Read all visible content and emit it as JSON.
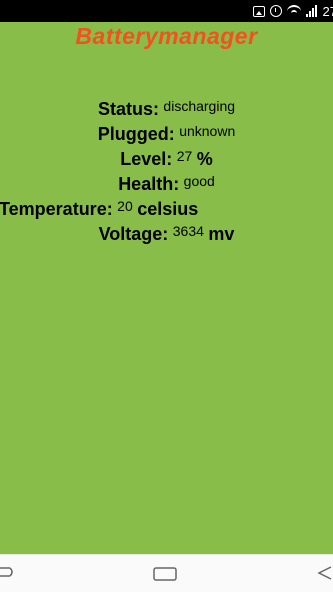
{
  "status_bar": {
    "battery_percent": "27",
    "icons": [
      "image-icon",
      "alarm-icon",
      "wifi-icon",
      "signal-icon"
    ]
  },
  "app": {
    "title": "Batterymanager",
    "title_color": "#f4511e",
    "background_color": "#88bd4a"
  },
  "battery": {
    "status_label": "Status:",
    "status_value": "discharging",
    "plugged_label": "Plugged:",
    "plugged_value": "unknown",
    "level_label": "Level:",
    "level_value": "27",
    "level_unit": "%",
    "health_label": "Health:",
    "health_value": "good",
    "temperature_label": "Temperature:",
    "temperature_value": "20",
    "temperature_unit": "celsius",
    "voltage_label": "Voltage:",
    "voltage_value": "3634",
    "voltage_unit": "mv"
  },
  "navbar": {
    "icons": [
      "back-icon",
      "home-icon",
      "recents-icon"
    ]
  }
}
